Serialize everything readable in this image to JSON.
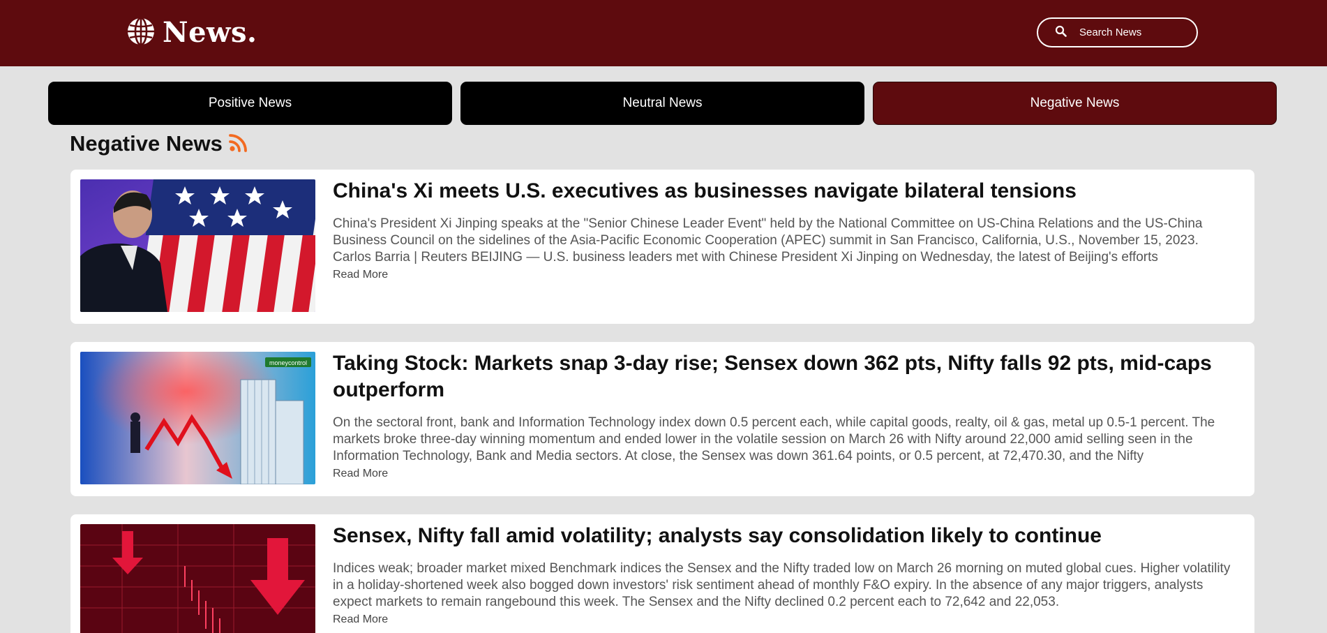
{
  "header": {
    "logo_text": "News.",
    "logo_icon": "globe-icon",
    "search": {
      "label": "Search News",
      "icon": "search-icon"
    }
  },
  "tabs": [
    {
      "label": "Positive News",
      "active": false
    },
    {
      "label": "Neutral News",
      "active": false
    },
    {
      "label": "Negative News",
      "active": true
    }
  ],
  "section": {
    "title": "Negative News",
    "icon": "rss-icon"
  },
  "colors": {
    "brand": "#5e0b0e",
    "tab_inactive": "#000000",
    "rss": "#f26a21",
    "background": "#e2e2e2"
  },
  "articles": [
    {
      "title": "China's Xi meets U.S. executives as businesses navigate bilateral tensions",
      "summary": "China's President Xi Jinping speaks at the \"Senior Chinese Leader Event\" held by the National Committee on US-China Relations and the US-China Business Council on the sidelines of the Asia-Pacific Economic Cooperation (APEC) summit in San Francisco, California, U.S., November 15, 2023. Carlos Barria | Reuters BEIJING — U.S. business leaders met with Chinese President Xi Jinping on Wednesday, the latest of Beijing's efforts",
      "read_more": "Read More"
    },
    {
      "title": "Taking Stock: Markets snap 3-day rise; Sensex down 362 pts, Nifty falls 92 pts, mid-caps outperform",
      "summary": "On the sectoral front, bank and Information Technology index down 0.5 percent each, while capital goods, realty, oil & gas, metal up 0.5-1 percent. The markets broke three-day winning momentum and ended lower in the volatile session on March 26 with Nifty around 22,000 amid selling seen in the Information Technology, Bank and Media sectors. At close, the Sensex was down 361.64 points, or 0.5 percent, at 72,470.30, and the Nifty",
      "read_more": "Read More",
      "image_badge": "moneycontrol"
    },
    {
      "title": "Sensex, Nifty fall amid volatility; analysts say consolidation likely to continue",
      "summary": "Indices weak; broader market mixed Benchmark indices the Sensex and the Nifty traded low on March 26 morning on muted global cues. Higher volatility in a holiday-shortened week also bogged down investors' risk sentiment ahead of monthly F&O expiry. In the absence of any major triggers, analysts expect markets to remain rangebound this week. The Sensex and the Nifty declined 0.2 percent each to 72,642 and 22,053.",
      "read_more": "Read More"
    }
  ]
}
